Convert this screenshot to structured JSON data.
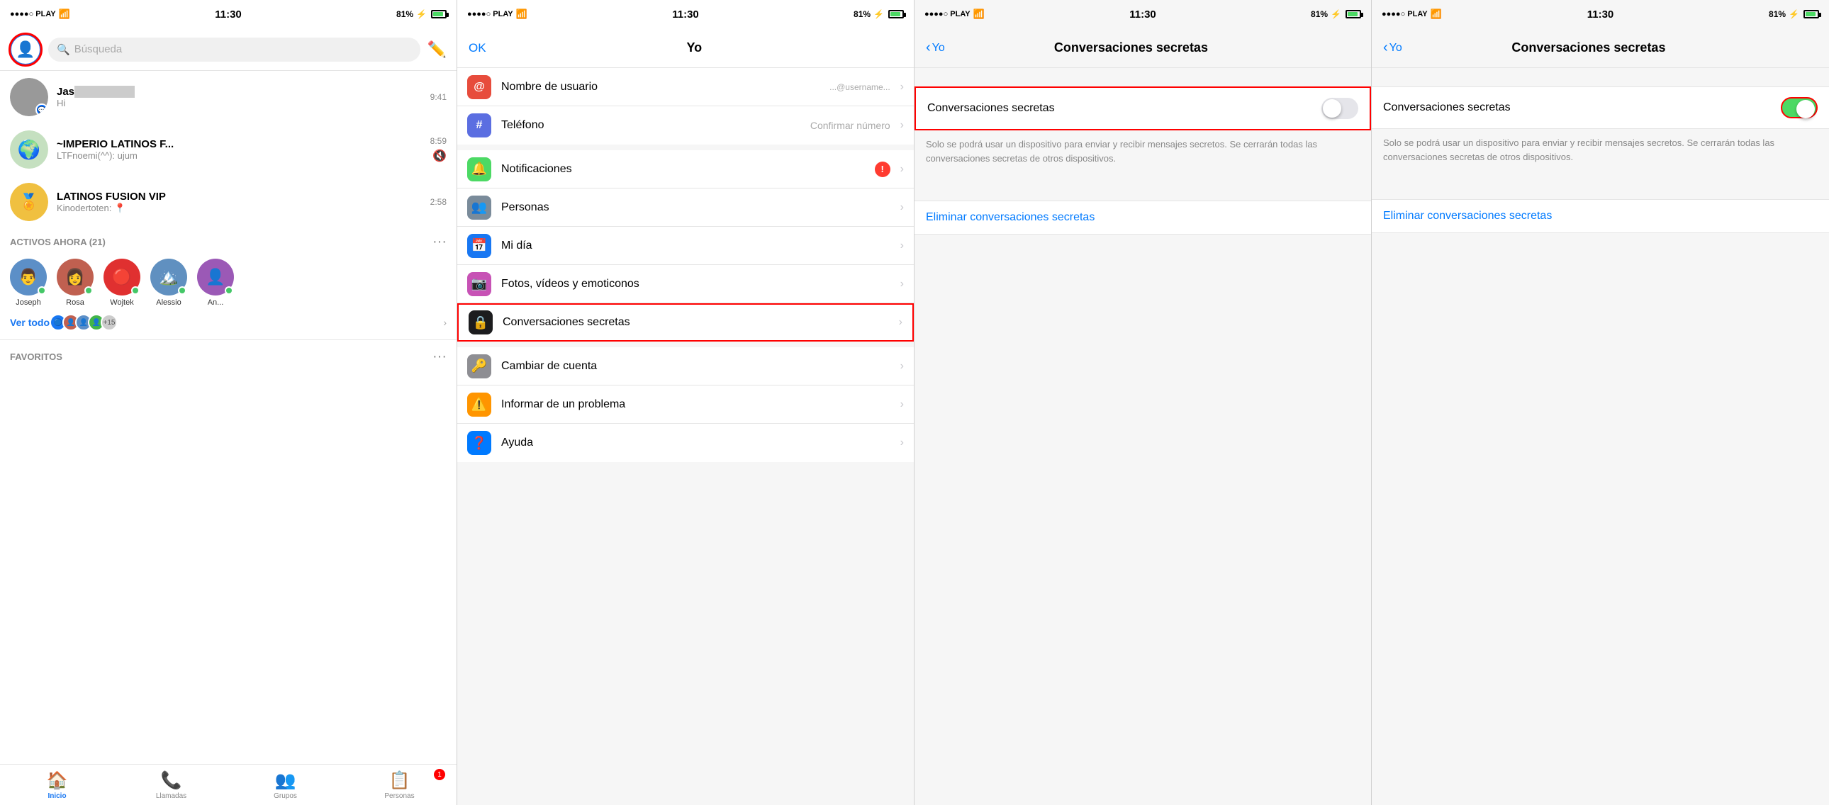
{
  "panels": [
    {
      "id": "panel1",
      "statusBar": {
        "carrier": "●●●●○ PLAY",
        "wifi": true,
        "time": "11:30",
        "battery": "81%",
        "charging": true
      },
      "header": {
        "searchPlaceholder": "Búsqueda"
      },
      "chats": [
        {
          "name": "Jas█████████",
          "preview": "Hi",
          "time": "9:41",
          "hasMessenger": true
        },
        {
          "name": "~IMPERIO LATINOS F...",
          "preview": "LTFnoemi(^^): ujum",
          "time": "8:59",
          "muted": true
        }
      ],
      "activeNow": {
        "title": "ACTIVOS AHORA (21)",
        "users": [
          {
            "name": "Joseph",
            "color": "#5c8fc7"
          },
          {
            "name": "Rosa",
            "color": "#c06050"
          },
          {
            "name": "Wojtek",
            "color": "#e03030"
          },
          {
            "name": "Alessio",
            "color": "#6090c0"
          },
          {
            "name": "An...",
            "color": "#9b59b6"
          }
        ]
      },
      "seeAll": {
        "label": "Ver todo",
        "plus": "+15"
      },
      "favorites": {
        "title": "FAVORITOS"
      },
      "tabs": [
        {
          "label": "Inicio",
          "icon": "🏠",
          "active": true
        },
        {
          "label": "Llamadas",
          "icon": "📞"
        },
        {
          "label": "Grupos",
          "icon": "👥"
        },
        {
          "label": "Personas",
          "icon": "📋",
          "badge": "1"
        }
      ]
    },
    {
      "id": "panel2",
      "statusBar": {
        "carrier": "●●●●○ PLAY",
        "wifi": true,
        "time": "11:30",
        "battery": "81%",
        "charging": true
      },
      "header": {
        "okLabel": "OK",
        "title": "Yo"
      },
      "menuItems": [
        {
          "icon": "@",
          "iconBg": "#e74c3c",
          "label": "Nombre de usuario",
          "value": "...@username...",
          "highlighted": false
        },
        {
          "icon": "#",
          "iconBg": "#5b6ee1",
          "label": "Teléfono",
          "value": "Confirmar número",
          "highlighted": false
        },
        {
          "icon": "🔔",
          "iconBg": "#4cd964",
          "label": "Notificaciones",
          "hasBadge": true,
          "highlighted": false
        },
        {
          "icon": "👥",
          "iconBg": "#7a8b9a",
          "label": "Personas",
          "highlighted": false
        },
        {
          "icon": "📅",
          "iconBg": "#1877f2",
          "label": "Mi día",
          "highlighted": false
        },
        {
          "icon": "📷",
          "iconBg": "#c752b5",
          "label": "Fotos, vídeos y emoticonos",
          "highlighted": false
        },
        {
          "icon": "🔒",
          "iconBg": "#2c2c2c",
          "label": "Conversaciones secretas",
          "highlighted": true
        },
        {
          "icon": "🔑",
          "iconBg": "#8e8e93",
          "label": "Cambiar de cuenta",
          "highlighted": false
        },
        {
          "icon": "⚠️",
          "iconBg": "#ff9500",
          "label": "Informar de un problema",
          "highlighted": false
        },
        {
          "icon": "❓",
          "iconBg": "#007aff",
          "label": "Ayuda",
          "highlighted": false
        }
      ]
    },
    {
      "id": "panel3",
      "statusBar": {
        "carrier": "●●●●○ PLAY",
        "wifi": true,
        "time": "11:30",
        "battery": "81%",
        "charging": true
      },
      "header": {
        "backLabel": "Yo",
        "title": "Conversaciones secretas"
      },
      "toggleLabel": "Conversaciones secretas",
      "toggleState": false,
      "description": "Solo se podrá usar un dispositivo para enviar y recibir mensajes secretos. Se cerrarán todas las conversaciones secretas de otros dispositivos.",
      "actionLabel": "Eliminar conversaciones secretas"
    },
    {
      "id": "panel4",
      "statusBar": {
        "carrier": "●●●●○ PLAY",
        "wifi": true,
        "time": "11:30",
        "battery": "81%",
        "charging": true
      },
      "header": {
        "backLabel": "Yo",
        "title": "Conversaciones secretas"
      },
      "toggleLabel": "Conversaciones secretas",
      "toggleState": true,
      "description": "Solo se podrá usar un dispositivo para enviar y recibir mensajes secretos. Se cerrarán todas las conversaciones secretas de otros dispositivos.",
      "actionLabel": "Eliminar conversaciones secretas"
    }
  ]
}
